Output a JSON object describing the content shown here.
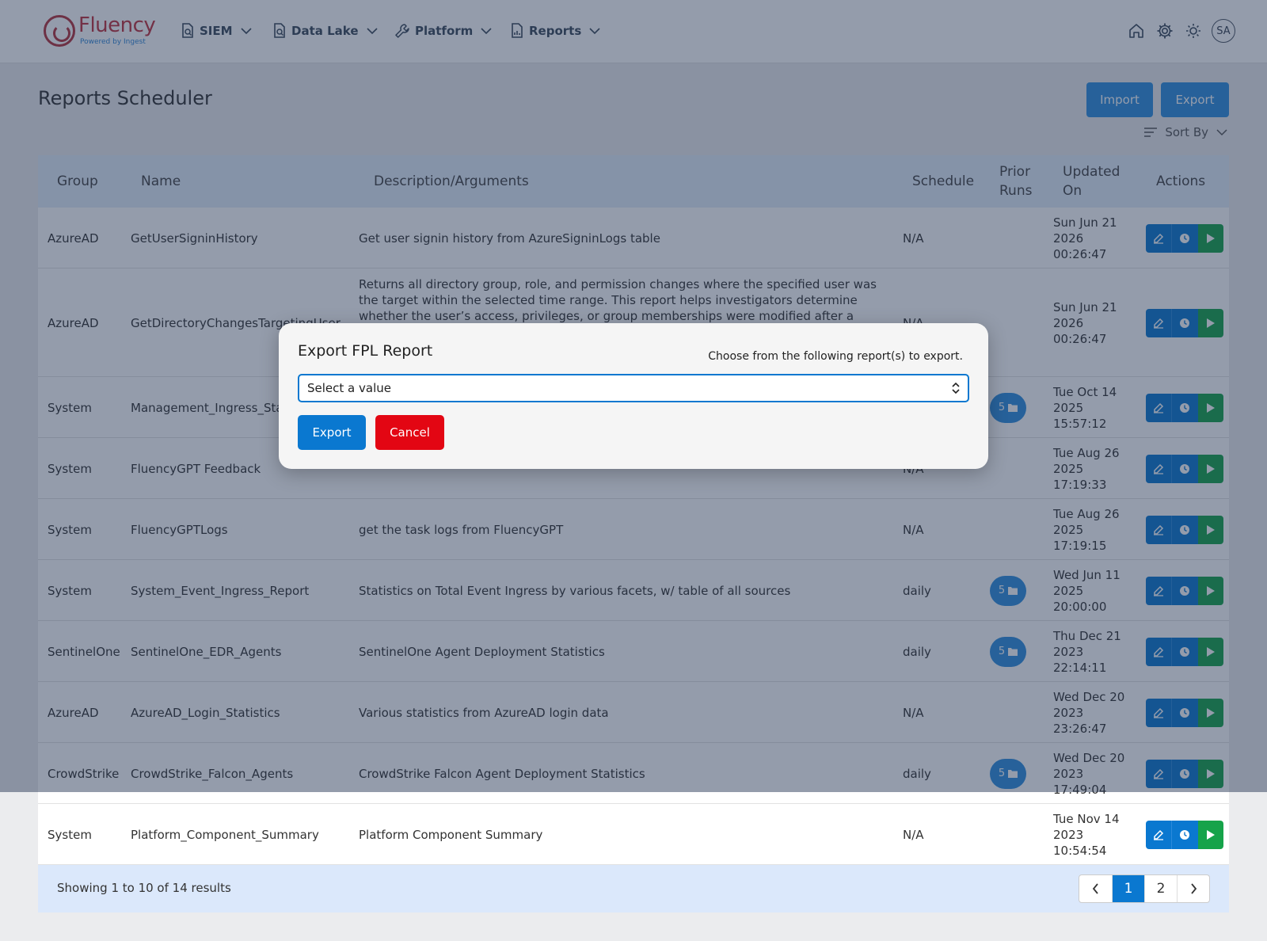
{
  "brand": {
    "name": "Fluency",
    "tagline": "Powered by Ingest"
  },
  "nav": {
    "items": [
      {
        "label": "SIEM"
      },
      {
        "label": "Data Lake"
      },
      {
        "label": "Platform"
      },
      {
        "label": "Reports"
      }
    ],
    "avatar_initials": "SA"
  },
  "page": {
    "title": "Reports Scheduler",
    "import_label": "Import",
    "export_label": "Export",
    "sort_label": "Sort By"
  },
  "table": {
    "columns": {
      "group": "Group",
      "name": "Name",
      "description": "Description/Arguments",
      "schedule": "Schedule",
      "prior_line1": "Prior",
      "prior_line2": "Runs",
      "updated_line1": "Updated",
      "updated_line2": "On",
      "actions": "Actions"
    },
    "rows": [
      {
        "group": "AzureAD",
        "name": "GetUserSigninHistory",
        "description": "Get user signin history from AzureSigninLogs table",
        "schedule": "N/A",
        "prior_runs": "",
        "updated_1": "Sun Jun 21",
        "updated_2": "2026",
        "updated_3": "00:26:47"
      },
      {
        "group": "AzureAD",
        "name": "GetDirectoryChangesTargetingUser",
        "description": "Returns all directory group, role, and permission changes where the specified user was the target within the selected time range. This report helps investigators determine whether the user’s access, privileges, or group memberships were modified after a security alert. Key",
        "schedule": "N/A",
        "prior_runs": "",
        "updated_1": "Sun Jun 21",
        "updated_2": "2026",
        "updated_3": "00:26:47"
      },
      {
        "group": "System",
        "name": "Management_Ingress_Statistics",
        "description": "",
        "schedule": "",
        "prior_runs": "5",
        "updated_1": "Tue Oct 14",
        "updated_2": "2025",
        "updated_3": "15:57:12"
      },
      {
        "group": "System",
        "name": "FluencyGPT Feedback",
        "description": "",
        "schedule": "N/A",
        "prior_runs": "",
        "updated_1": "Tue Aug 26",
        "updated_2": "2025",
        "updated_3": "17:19:33"
      },
      {
        "group": "System",
        "name": "FluencyGPTLogs",
        "description": "get the task logs from FluencyGPT",
        "schedule": "N/A",
        "prior_runs": "",
        "updated_1": "Tue Aug 26",
        "updated_2": "2025",
        "updated_3": "17:19:15"
      },
      {
        "group": "System",
        "name": "System_Event_Ingress_Report",
        "description": "Statistics on Total Event Ingress by various facets, w/ table of all sources",
        "schedule": "daily",
        "prior_runs": "5",
        "updated_1": "Wed Jun 11",
        "updated_2": "2025",
        "updated_3": "20:00:00"
      },
      {
        "group": "SentinelOne",
        "name": "SentinelOne_EDR_Agents",
        "description": "SentinelOne Agent Deployment Statistics",
        "schedule": "daily",
        "prior_runs": "5",
        "updated_1": "Thu Dec 21",
        "updated_2": "2023",
        "updated_3": "22:14:11"
      },
      {
        "group": "AzureAD",
        "name": "AzureAD_Login_Statistics",
        "description": "Various statistics from AzureAD login data",
        "schedule": "N/A",
        "prior_runs": "",
        "updated_1": "Wed Dec 20",
        "updated_2": "2023",
        "updated_3": "23:26:47"
      },
      {
        "group": "CrowdStrike",
        "name": "CrowdStrike_Falcon_Agents",
        "description": "CrowdStrike Falcon Agent Deployment Statistics",
        "schedule": "daily",
        "prior_runs": "5",
        "updated_1": "Wed Dec 20",
        "updated_2": "2023",
        "updated_3": "17:49:04"
      },
      {
        "group": "System",
        "name": "Platform_Component_Summary",
        "description": "Platform Component Summary",
        "schedule": "N/A",
        "prior_runs": "",
        "updated_1": "Tue Nov 14",
        "updated_2": "2023",
        "updated_3": "10:54:54"
      }
    ]
  },
  "pagination": {
    "summary": "Showing 1 to 10 of 14 results",
    "pages": [
      "1",
      "2"
    ],
    "current": "1"
  },
  "modal": {
    "title": "Export FPL Report",
    "hint": "Choose from the following report(s) to export.",
    "select_value": "Select a value",
    "export_label": "Export",
    "cancel_label": "Cancel"
  },
  "colors": {
    "primary": "#0a78d0",
    "success": "#16a34a",
    "danger": "#e30613",
    "brand": "#c0323f"
  },
  "icons": {
    "nav": [
      "report-file-icon",
      "report-file-icon",
      "wrench-icon",
      "document-chart-icon"
    ],
    "right": [
      "home-icon",
      "gear-icon",
      "sun-icon"
    ],
    "actions": [
      "edit-icon",
      "clock-icon",
      "play-icon"
    ],
    "prior_runs": "folder-icon"
  }
}
